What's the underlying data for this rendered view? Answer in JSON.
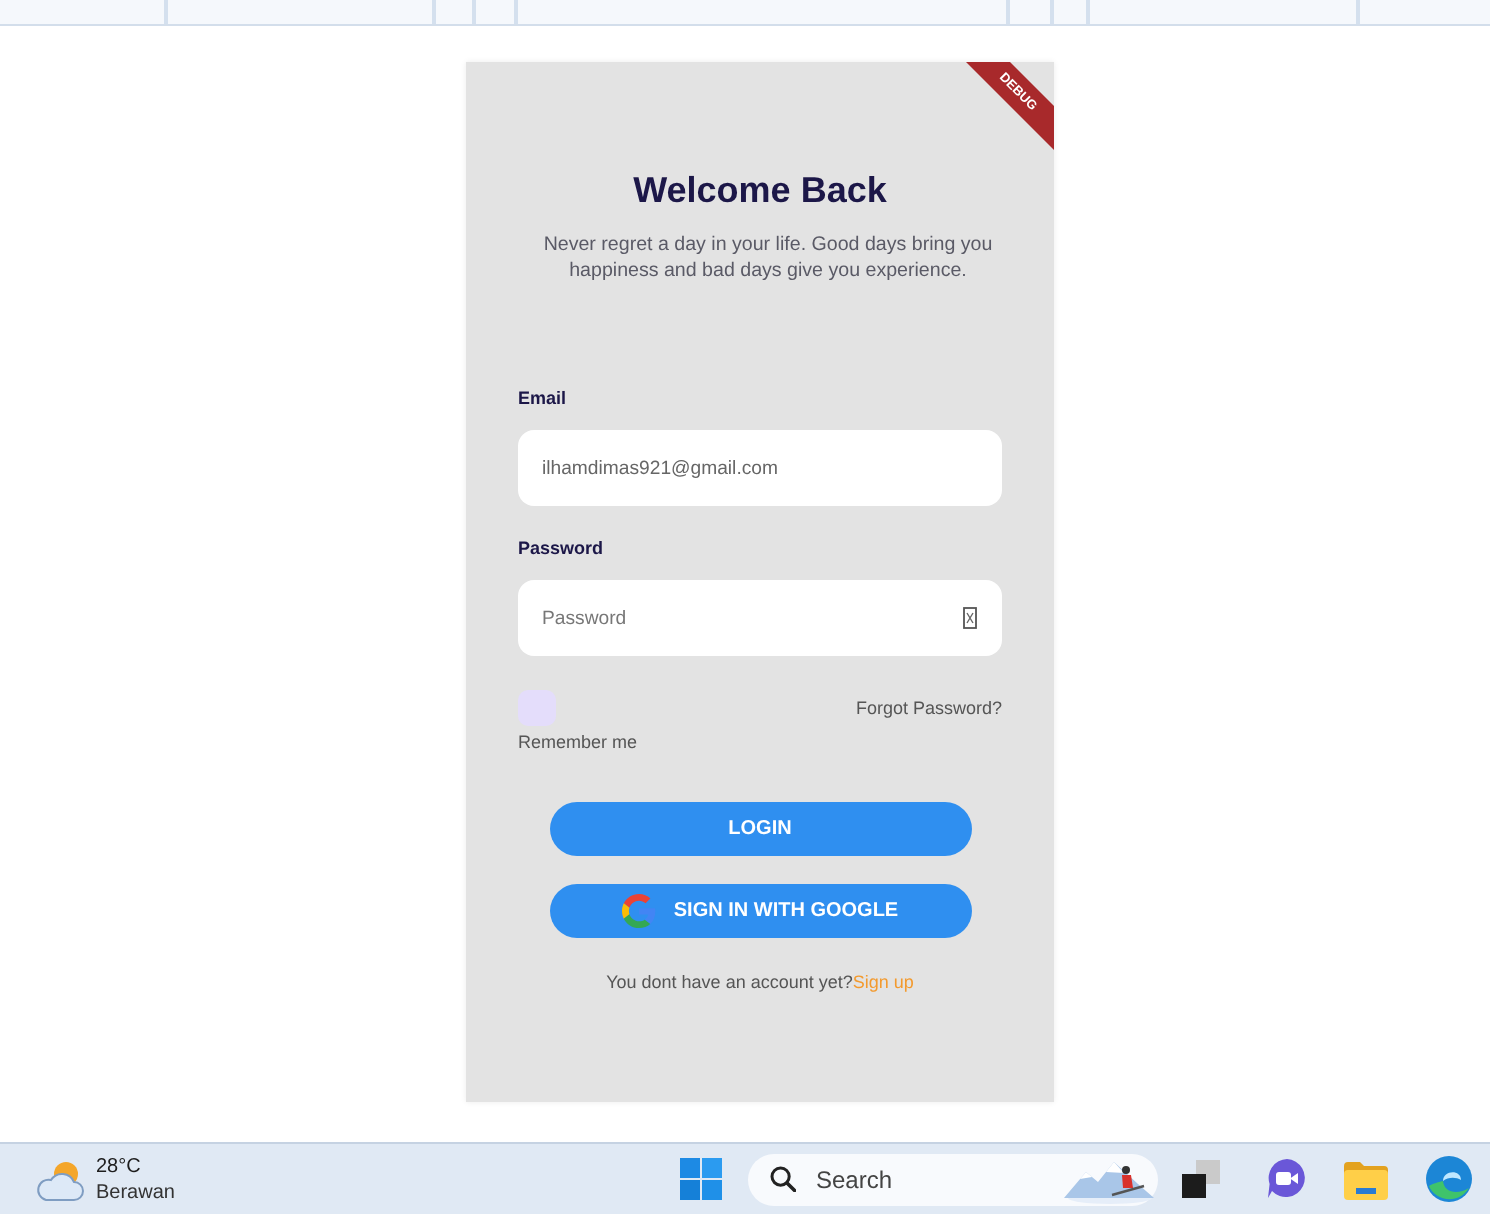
{
  "login_card": {
    "debug_banner": "DEBUG",
    "title": "Welcome Back",
    "subtitle": "Never regret a day in your life. Good days bring you happiness and bad days give you experience.",
    "fields": [
      {
        "kind": "email",
        "label": "Email",
        "value": "ilhamdimas921@gmail.com"
      },
      {
        "kind": "password",
        "label": "Password",
        "placeholder": "Password"
      }
    ],
    "remember": {
      "label": "Remember me",
      "checked": false
    },
    "forgot_link": "Forgot Password?",
    "buttons": [
      {
        "kind": "primary",
        "label": "LOGIN"
      },
      {
        "kind": "google",
        "label": "SIGN IN WITH GOOGLE"
      }
    ],
    "signup_prompt": {
      "text": "You dont have an account yet?",
      "link": "Sign up"
    }
  },
  "taskbar": {
    "weather": {
      "temperature": "28°C",
      "condition": "Berawan"
    },
    "search": {
      "placeholder": "Search"
    }
  }
}
